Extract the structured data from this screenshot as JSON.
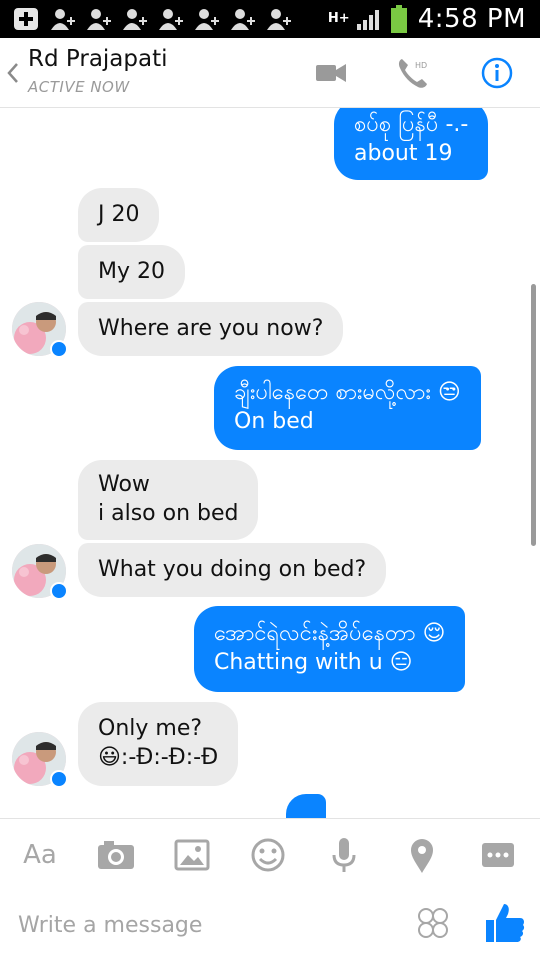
{
  "status_bar": {
    "network": "H+",
    "time": "4:58 PM",
    "icons": [
      "add-notification-icon",
      "contact-notification-icon",
      "contact-notification-icon",
      "contact-notification-icon",
      "contact-notification-icon",
      "contact-notification-icon",
      "contact-notification-icon",
      "contact-notification-icon",
      "signal-icon",
      "battery-icon"
    ]
  },
  "header": {
    "contact_name": "Rd Prajapati",
    "status": "ACTIVE NOW",
    "video_label": "video-camera-icon",
    "call_badge": "HD",
    "info_label": "info-icon"
  },
  "messages": [
    {
      "dir": "out",
      "text": "စပ်စု ပြန်ပီ -.-\nabout 19"
    },
    {
      "dir": "in",
      "text": "J 20"
    },
    {
      "dir": "in",
      "text": "My 20"
    },
    {
      "dir": "in",
      "text": "Where are you now?"
    },
    {
      "dir": "out",
      "text": "ချီးပါနေတေ စားမလို့လား 😒\nOn bed"
    },
    {
      "dir": "in",
      "text": "Wow\ni also on bed"
    },
    {
      "dir": "in",
      "text": "What you doing on bed?"
    },
    {
      "dir": "out",
      "text": "အောင်ရဲလင်းနဲ့အိပ်နေတာ 😌\nChatting with u 😑"
    },
    {
      "dir": "in",
      "text": "Only me?\n😃:-Ð:-Ð:-Ð"
    },
    {
      "dir": "out",
      "text": ""
    }
  ],
  "toolbar": {
    "text_label": "Aa",
    "items": [
      "camera-icon",
      "gallery-icon",
      "emoji-icon",
      "microphone-icon",
      "location-icon",
      "more-icon"
    ]
  },
  "composer": {
    "placeholder": "Write a message"
  },
  "colors": {
    "accent": "#0a84ff",
    "incoming_bubble": "#ebebeb",
    "icon_gray": "#a7a7a7"
  }
}
